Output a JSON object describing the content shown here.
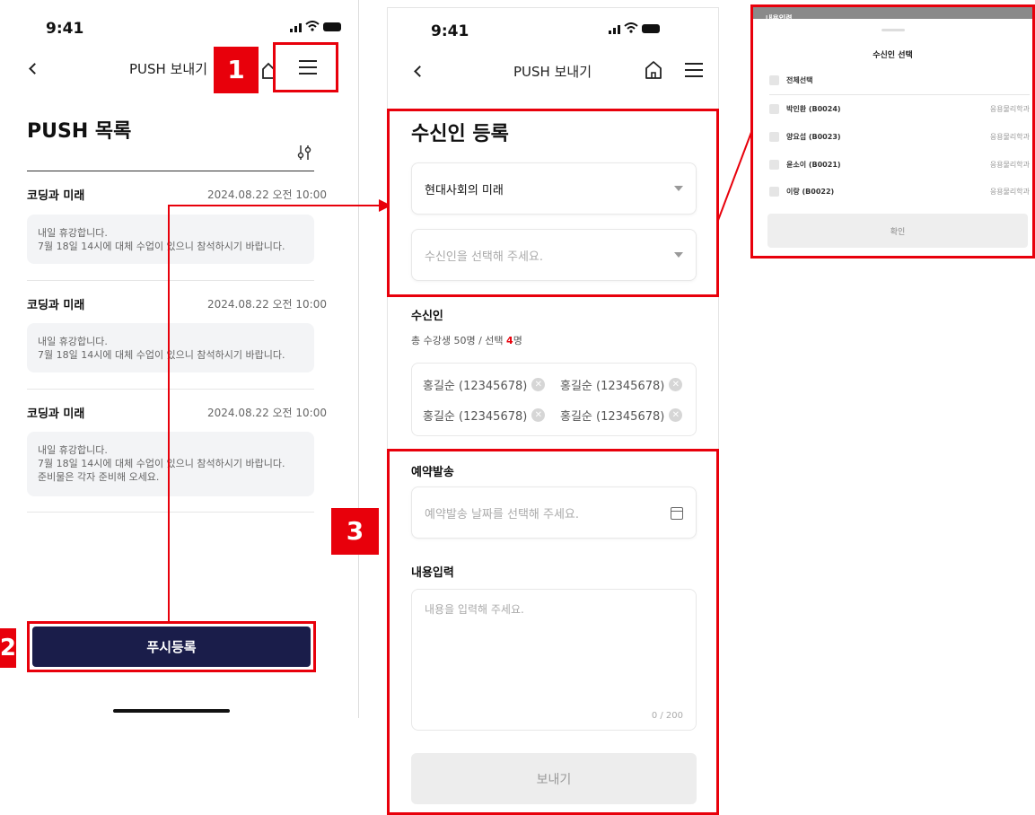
{
  "screen1": {
    "time": "9:41",
    "nav_title": "PUSH 보내기",
    "list_heading": "PUSH 목록",
    "items": [
      {
        "title": "코딩과 미래",
        "date": "2024.08.22 오전 10:00",
        "lines": [
          "내일 휴강합니다.",
          "7월 18일 14시에 대체 수업이 있으니 참석하시기 바랍니다."
        ]
      },
      {
        "title": "코딩과 미래",
        "date": "2024.08.22 오전 10:00",
        "lines": [
          "내일 휴강합니다.",
          "7월 18일 14시에 대체 수업이 있으니 참석하시기 바랍니다."
        ]
      },
      {
        "title": "코딩과 미래",
        "date": "2024.08.22 오전 10:00",
        "lines": [
          "내일 휴강합니다.",
          "7월 18일 14시에 대체 수업이 있으니 참석하시기 바랍니다.",
          "준비물은 각자 준비해 오세요."
        ]
      }
    ],
    "push_register": "푸시등록"
  },
  "screen2": {
    "time": "9:41",
    "nav_title": "PUSH 보내기",
    "section_title": "수신인 등록",
    "course_select": "현대사회의 미래",
    "recipient_placeholder": "수신인을 선택해 주세요.",
    "recipient_label": "수신인",
    "count_prefix": "총 수강생 50명 / 선택 ",
    "count_selected": "4",
    "count_suffix": "명",
    "chips": [
      "홍길순 (12345678)",
      "홍길순 (12345678)",
      "홍길순 (12345678)",
      "홍길순 (12345678)"
    ],
    "reserve_label": "예약발송",
    "reserve_placeholder": "예약발송 날짜를 선택해 주세요.",
    "content_label": "내용입력",
    "content_placeholder": "내용을 입력해 주세요.",
    "counter": "0 / 200",
    "send": "보내기"
  },
  "popup": {
    "bar_title": "내용입력",
    "title": "수신인 선택",
    "select_all": "전체선택",
    "rows": [
      {
        "name": "박인환 (B0024)",
        "dept": "응용물리학과"
      },
      {
        "name": "양요섭 (B0023)",
        "dept": "응용물리학과"
      },
      {
        "name": "윤소이 (B0021)",
        "dept": "응용물리학과"
      },
      {
        "name": "이랑 (B0022)",
        "dept": "응용물리학과"
      }
    ],
    "confirm": "확인"
  },
  "labels": {
    "one": "1",
    "two": "2",
    "three": "3"
  },
  "colors": {
    "accent_red": "#e8000b",
    "navy": "#1a1d4a"
  }
}
